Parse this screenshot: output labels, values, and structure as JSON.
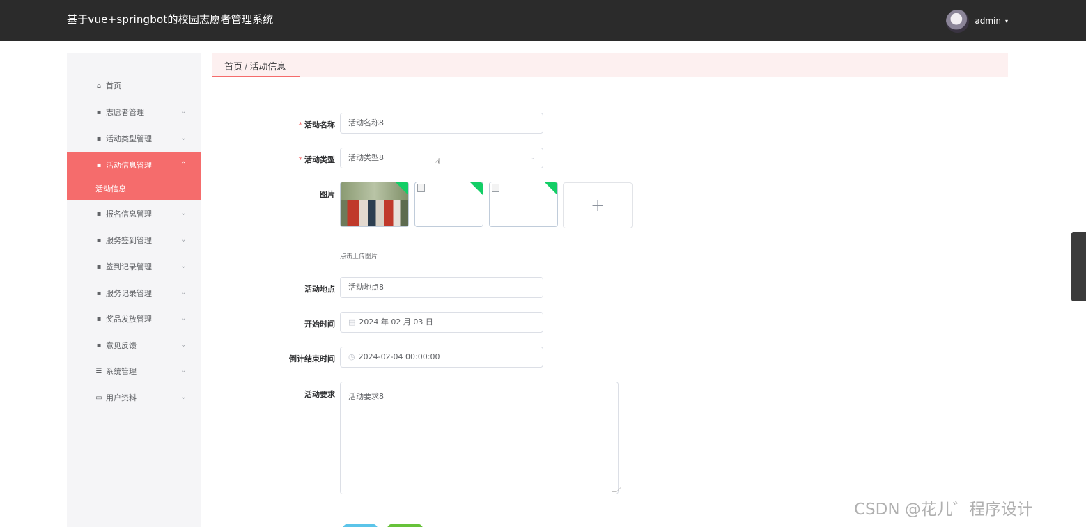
{
  "header": {
    "title": "基于vue+springbot的校园志愿者管理系统",
    "user": {
      "name": "admin",
      "caret": "▾"
    }
  },
  "sidebar": {
    "items": [
      {
        "label": "首页",
        "icon": "⌂"
      },
      {
        "label": "志愿者管理",
        "icon": "▪"
      },
      {
        "label": "活动类型管理",
        "icon": "▪"
      },
      {
        "label": "活动信息管理",
        "icon": "▪",
        "expanded": true,
        "active": true,
        "children": [
          "活动信息"
        ]
      },
      {
        "label": "报名信息管理",
        "icon": "▪"
      },
      {
        "label": "服务签到管理",
        "icon": "▪"
      },
      {
        "label": "签到记录管理",
        "icon": "▪"
      },
      {
        "label": "服务记录管理",
        "icon": "▪"
      },
      {
        "label": "奖品发放管理",
        "icon": "▪"
      },
      {
        "label": "意见反馈",
        "icon": "▪"
      },
      {
        "label": "系统管理",
        "icon": "☰"
      },
      {
        "label": "用户资料",
        "icon": "▭"
      }
    ],
    "submenu_active": "活动信息",
    "chevron_down": "⌄",
    "chevron_up": "⌃"
  },
  "breadcrumb": {
    "home": "首页",
    "separator": "/",
    "current": "活动信息"
  },
  "form": {
    "required_mark": "*",
    "name": {
      "label": "活动名称",
      "value": "活动名称8"
    },
    "type": {
      "label": "活动类型",
      "value": "活动类型8"
    },
    "image": {
      "label": "图片",
      "count": 3,
      "tip": "点击上传图片",
      "plus": "+"
    },
    "location": {
      "label": "活动地点",
      "value": "活动地点8"
    },
    "start_time": {
      "label": "开始时间",
      "value": "2024 年 02 月 03 日",
      "icon": "▤"
    },
    "end_time": {
      "label": "倒计结束时间",
      "value": "2024-02-04 00:00:00",
      "icon": "◷"
    },
    "requirement": {
      "label": "活动要求",
      "value": "活动要求8"
    }
  },
  "watermark": "CSDN @花儿゛程序设计",
  "colors": {
    "accent": "#f56c6c",
    "header_bg": "#2b2b2b",
    "success": "#13ce66"
  }
}
